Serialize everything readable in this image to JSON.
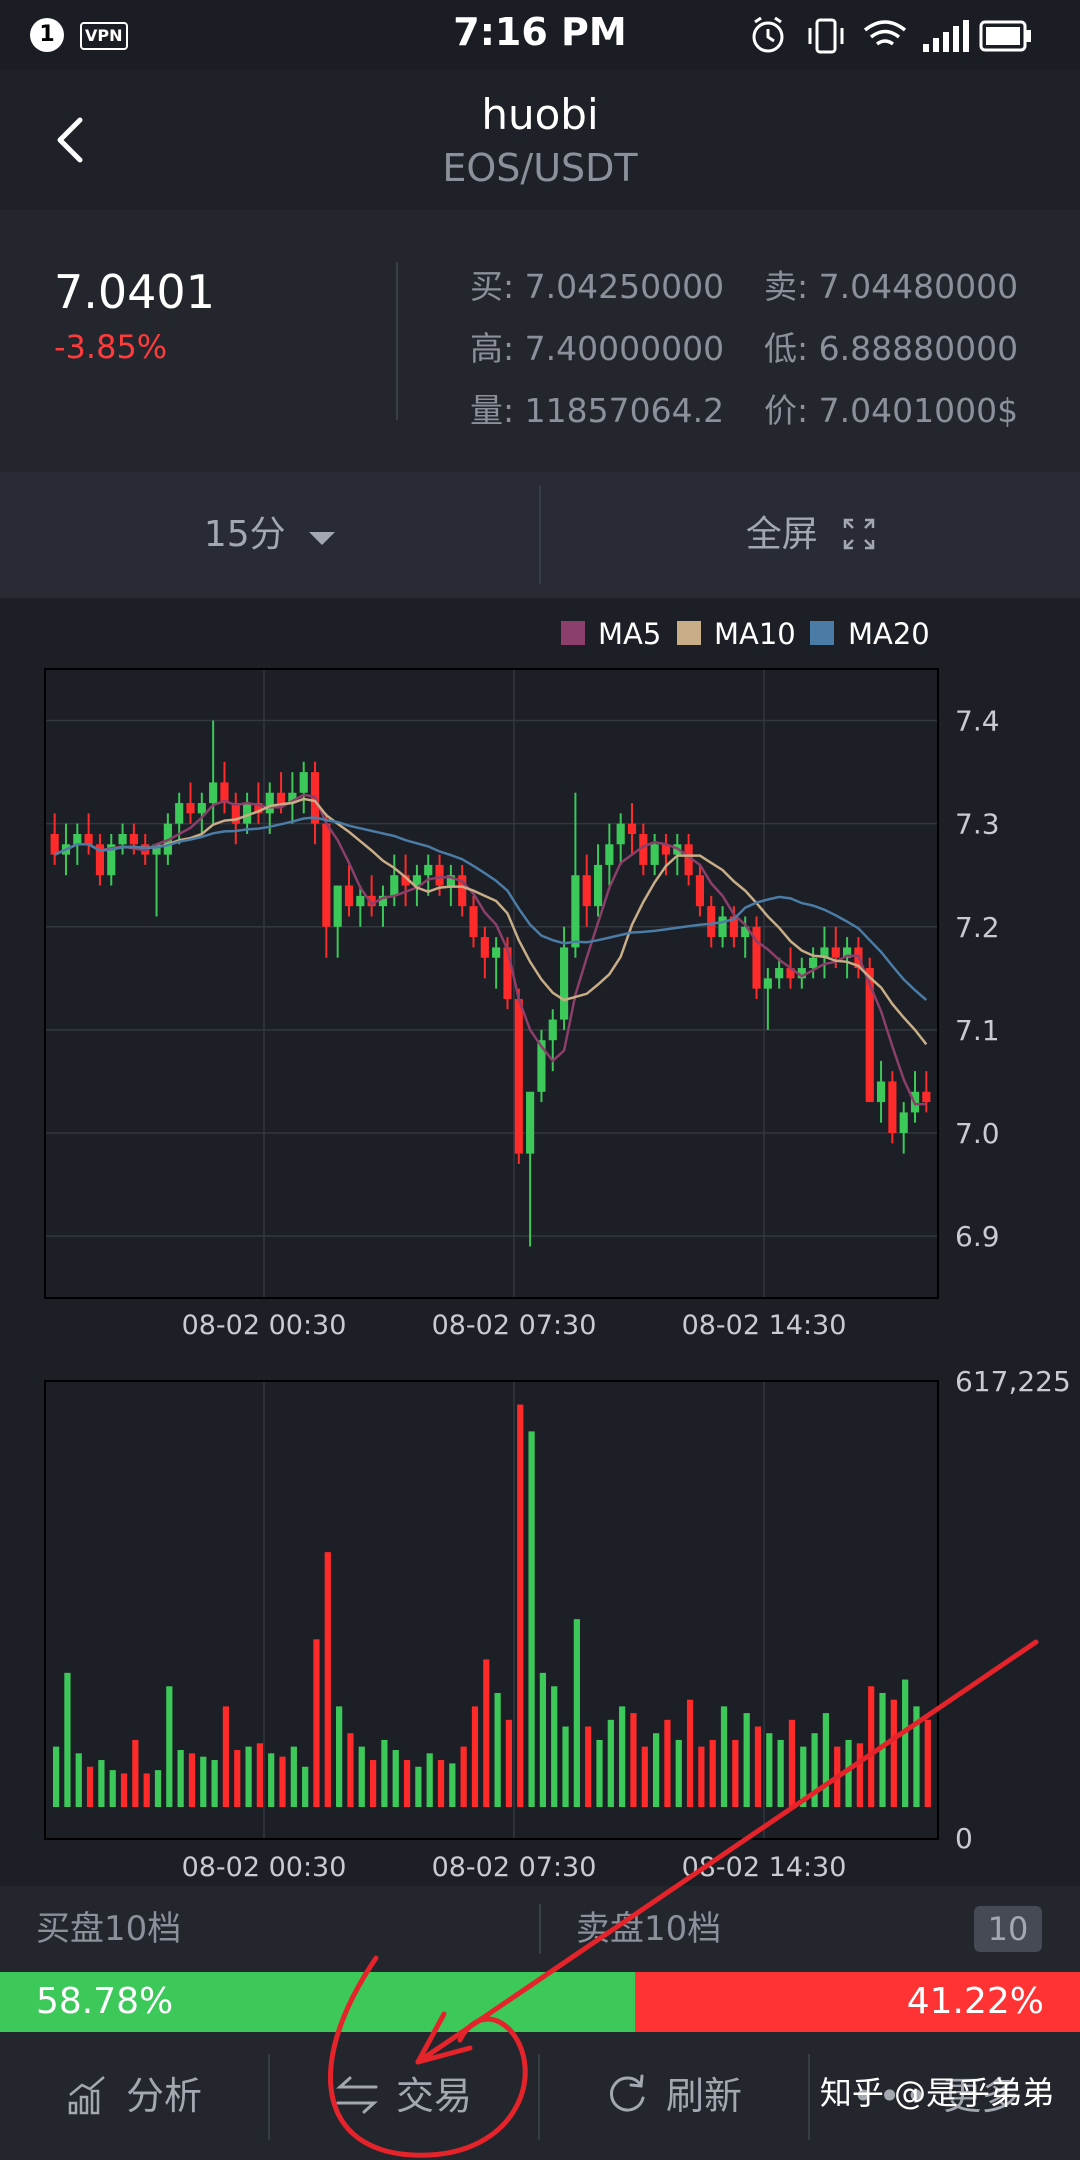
{
  "status_bar": {
    "time": "7:16 PM",
    "notification_count": "1",
    "vpn_label": "VPN"
  },
  "header": {
    "title": "huobi",
    "pair": "EOS/USDT"
  },
  "quote": {
    "price": "7.0401",
    "change": "-3.85%",
    "buy_label": "买:",
    "buy_value": "7.04250000",
    "sell_label": "卖:",
    "sell_value": "7.04480000",
    "high_label": "高:",
    "high_value": "7.40000000",
    "low_label": "低:",
    "low_value": "6.88880000",
    "volume_label": "量:",
    "volume_value": "11857064.2",
    "price_label": "价:",
    "price_value": "7.0401000$"
  },
  "tabs": {
    "interval": "15分",
    "fullscreen": "全屏"
  },
  "colors": {
    "up": "#3cc95a",
    "down": "#ff2a2a",
    "ma5": "#8b3f6a",
    "ma10": "#c8ad87",
    "ma20": "#4a7ca6",
    "grid": "#33373f"
  },
  "chart_data": [
    {
      "type": "candlestick",
      "legend": [
        "MA5",
        "MA10",
        "MA20"
      ],
      "y_ticks": [
        "7.4",
        "7.3",
        "7.2",
        "7.1",
        "7.0",
        "6.9"
      ],
      "x_ticks": [
        "08-02 00:30",
        "08-02 07:30",
        "08-02 14:30"
      ],
      "ylim": [
        6.84,
        7.45
      ],
      "candles": [
        [
          7.29,
          7.31,
          7.26,
          7.27
        ],
        [
          7.27,
          7.3,
          7.25,
          7.28
        ],
        [
          7.28,
          7.3,
          7.26,
          7.29
        ],
        [
          7.29,
          7.31,
          7.27,
          7.28
        ],
        [
          7.28,
          7.29,
          7.24,
          7.25
        ],
        [
          7.25,
          7.29,
          7.24,
          7.28
        ],
        [
          7.28,
          7.3,
          7.27,
          7.29
        ],
        [
          7.29,
          7.3,
          7.27,
          7.28
        ],
        [
          7.28,
          7.29,
          7.26,
          7.27
        ],
        [
          7.27,
          7.28,
          7.21,
          7.28
        ],
        [
          7.27,
          7.31,
          7.26,
          7.3
        ],
        [
          7.3,
          7.33,
          7.28,
          7.32
        ],
        [
          7.32,
          7.34,
          7.3,
          7.31
        ],
        [
          7.31,
          7.33,
          7.29,
          7.32
        ],
        [
          7.32,
          7.4,
          7.3,
          7.34
        ],
        [
          7.34,
          7.36,
          7.31,
          7.32
        ],
        [
          7.32,
          7.33,
          7.28,
          7.3
        ],
        [
          7.3,
          7.33,
          7.29,
          7.32
        ],
        [
          7.32,
          7.34,
          7.3,
          7.31
        ],
        [
          7.31,
          7.34,
          7.29,
          7.33
        ],
        [
          7.33,
          7.35,
          7.31,
          7.32
        ],
        [
          7.32,
          7.35,
          7.3,
          7.33
        ],
        [
          7.33,
          7.36,
          7.31,
          7.35
        ],
        [
          7.35,
          7.36,
          7.28,
          7.3
        ],
        [
          7.3,
          7.31,
          7.17,
          7.2
        ],
        [
          7.2,
          7.22,
          7.17,
          7.24
        ],
        [
          7.24,
          7.26,
          7.21,
          7.22
        ],
        [
          7.22,
          7.24,
          7.2,
          7.23
        ],
        [
          7.23,
          7.25,
          7.21,
          7.22
        ],
        [
          7.22,
          7.24,
          7.2,
          7.23
        ],
        [
          7.23,
          7.27,
          7.22,
          7.25
        ],
        [
          7.25,
          7.27,
          7.22,
          7.24
        ],
        [
          7.24,
          7.26,
          7.22,
          7.25
        ],
        [
          7.25,
          7.27,
          7.23,
          7.26
        ],
        [
          7.26,
          7.27,
          7.23,
          7.24
        ],
        [
          7.24,
          7.26,
          7.22,
          7.25
        ],
        [
          7.25,
          7.26,
          7.21,
          7.22
        ],
        [
          7.22,
          7.23,
          7.18,
          7.19
        ],
        [
          7.19,
          7.2,
          7.15,
          7.17
        ],
        [
          7.17,
          7.19,
          7.14,
          7.18
        ],
        [
          7.18,
          7.19,
          7.12,
          7.13
        ],
        [
          7.13,
          7.14,
          6.97,
          6.98
        ],
        [
          6.98,
          7.02,
          6.89,
          7.04
        ],
        [
          7.04,
          7.1,
          7.03,
          7.09
        ],
        [
          7.09,
          7.12,
          7.06,
          7.11
        ],
        [
          7.11,
          7.2,
          7.1,
          7.18
        ],
        [
          7.18,
          7.33,
          7.17,
          7.25
        ],
        [
          7.25,
          7.27,
          7.2,
          7.22
        ],
        [
          7.22,
          7.28,
          7.21,
          7.26
        ],
        [
          7.26,
          7.3,
          7.24,
          7.28
        ],
        [
          7.28,
          7.31,
          7.26,
          7.3
        ],
        [
          7.3,
          7.32,
          7.27,
          7.29
        ],
        [
          7.29,
          7.3,
          7.25,
          7.26
        ],
        [
          7.26,
          7.29,
          7.25,
          7.28
        ],
        [
          7.28,
          7.29,
          7.25,
          7.27
        ],
        [
          7.27,
          7.29,
          7.25,
          7.28
        ],
        [
          7.28,
          7.29,
          7.24,
          7.25
        ],
        [
          7.25,
          7.26,
          7.21,
          7.22
        ],
        [
          7.22,
          7.23,
          7.18,
          7.19
        ],
        [
          7.19,
          7.22,
          7.18,
          7.21
        ],
        [
          7.21,
          7.22,
          7.18,
          7.19
        ],
        [
          7.19,
          7.21,
          7.17,
          7.2
        ],
        [
          7.2,
          7.21,
          7.13,
          7.14
        ],
        [
          7.14,
          7.16,
          7.1,
          7.15
        ],
        [
          7.15,
          7.17,
          7.14,
          7.16
        ],
        [
          7.16,
          7.18,
          7.14,
          7.15
        ],
        [
          7.15,
          7.17,
          7.14,
          7.16
        ],
        [
          7.16,
          7.18,
          7.15,
          7.17
        ],
        [
          7.17,
          7.2,
          7.15,
          7.18
        ],
        [
          7.18,
          7.2,
          7.16,
          7.17
        ],
        [
          7.17,
          7.19,
          7.15,
          7.18
        ],
        [
          7.18,
          7.19,
          7.15,
          7.16
        ],
        [
          7.16,
          7.17,
          7.08,
          7.03
        ],
        [
          7.03,
          7.07,
          7.01,
          7.05
        ],
        [
          7.05,
          7.06,
          6.99,
          7.0
        ],
        [
          7.0,
          7.03,
          6.98,
          7.02
        ],
        [
          7.02,
          7.06,
          7.01,
          7.04
        ],
        [
          7.04,
          7.06,
          7.02,
          7.03
        ]
      ]
    },
    {
      "type": "bar",
      "y_ticks": [
        "617,225",
        "0"
      ],
      "x_ticks": [
        "08-02 00:30",
        "08-02 07:30",
        "08-02 14:30"
      ],
      "ylim": [
        0,
        617225
      ],
      "values": [
        90000,
        200000,
        80000,
        60000,
        70000,
        55000,
        50000,
        100000,
        50000,
        55000,
        180000,
        85000,
        80000,
        75000,
        70000,
        150000,
        85000,
        90000,
        95000,
        80000,
        75000,
        90000,
        60000,
        250000,
        380000,
        150000,
        110000,
        90000,
        70000,
        100000,
        85000,
        70000,
        60000,
        80000,
        70000,
        65000,
        90000,
        150000,
        220000,
        170000,
        130000,
        600000,
        560000,
        200000,
        180000,
        120000,
        280000,
        120000,
        100000,
        130000,
        150000,
        140000,
        90000,
        110000,
        130000,
        100000,
        160000,
        90000,
        100000,
        150000,
        100000,
        140000,
        120000,
        110000,
        100000,
        130000,
        90000,
        110000,
        140000,
        90000,
        100000,
        95000,
        180000,
        170000,
        160000,
        190000,
        150000,
        130000
      ],
      "directions": [
        "up",
        "up",
        "up",
        "down",
        "up",
        "up",
        "down",
        "down",
        "down",
        "up",
        "up",
        "up",
        "down",
        "up",
        "up",
        "down",
        "down",
        "up",
        "down",
        "up",
        "down",
        "up",
        "up",
        "down",
        "down",
        "up",
        "down",
        "up",
        "down",
        "up",
        "up",
        "down",
        "up",
        "up",
        "down",
        "up",
        "down",
        "down",
        "down",
        "up",
        "down",
        "down",
        "up",
        "up",
        "up",
        "up",
        "up",
        "down",
        "up",
        "up",
        "up",
        "down",
        "down",
        "up",
        "down",
        "up",
        "down",
        "down",
        "down",
        "up",
        "down",
        "up",
        "down",
        "up",
        "up",
        "down",
        "up",
        "up",
        "up",
        "down",
        "up",
        "down",
        "down",
        "up",
        "down",
        "up",
        "up",
        "down"
      ]
    }
  ],
  "order_book": {
    "buy_label": "买盘10档",
    "sell_label": "卖盘10档",
    "depth": "10",
    "buy_ratio": "58.78%",
    "sell_ratio": "41.22%",
    "buy_fraction": 0.5878
  },
  "nav": {
    "analysis": "分析",
    "trade": "交易",
    "refresh": "刷新",
    "more": "更多"
  },
  "watermark": "知乎 @是乎弟弟"
}
